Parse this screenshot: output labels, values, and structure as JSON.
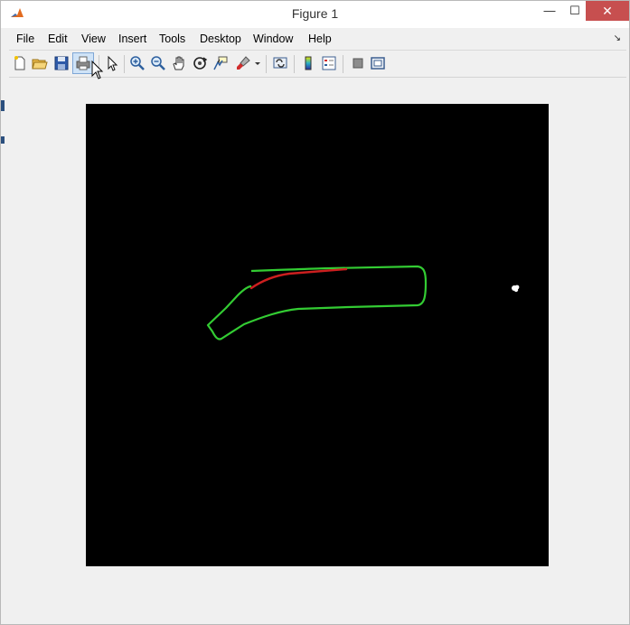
{
  "window": {
    "title": "Figure 1",
    "minimize_glyph": "—",
    "maximize_glyph": "☐",
    "close_glyph": "✕"
  },
  "menubar": {
    "items": [
      "File",
      "Edit",
      "View",
      "Insert",
      "Tools",
      "Desktop",
      "Window",
      "Help"
    ],
    "overflow_glyph": "↘"
  },
  "toolbar": {
    "buttons": [
      "new-figure-icon",
      "open-file-icon",
      "save-figure-icon",
      "print-figure-icon",
      "edit-plot-icon",
      "zoom-in-icon",
      "zoom-out-icon",
      "pan-icon",
      "rotate-3d-icon",
      "data-cursor-icon",
      "brush-icon",
      "link-plot-icon",
      "insert-colorbar-icon",
      "insert-legend-icon",
      "hide-plot-tools-icon",
      "show-plot-tools-icon"
    ],
    "active_button": "print-figure-icon"
  },
  "axes": {
    "background": "#000000",
    "contour_colors": {
      "primary": "#33cc33",
      "highlight": "#cc1f1f"
    }
  }
}
